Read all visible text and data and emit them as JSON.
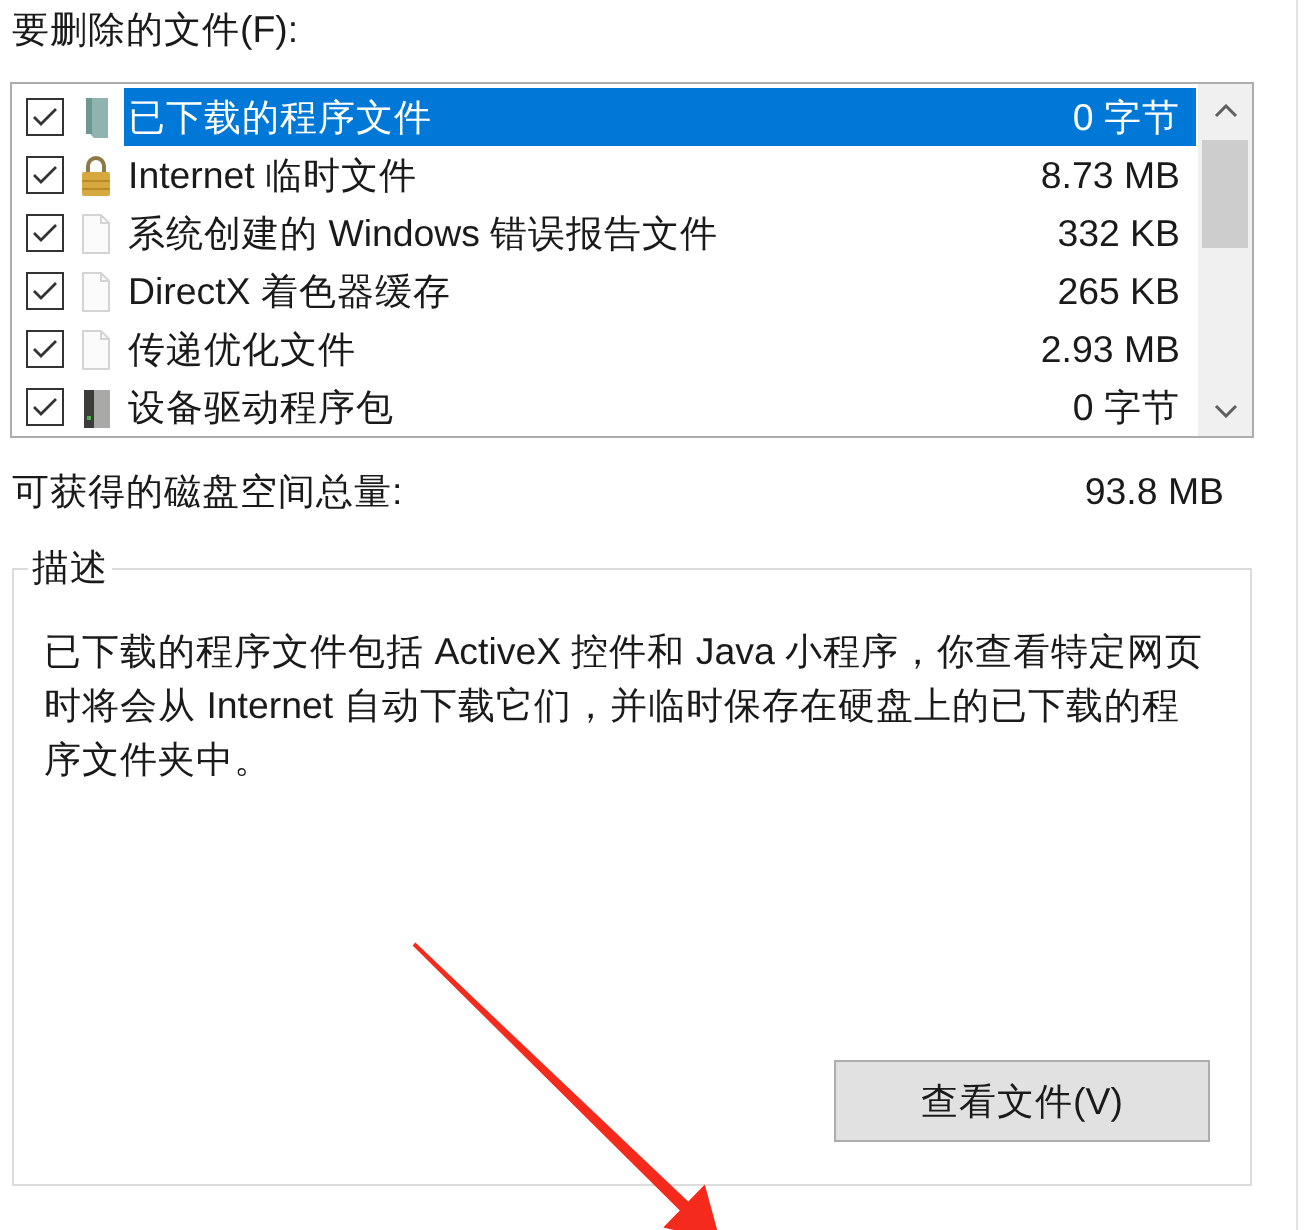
{
  "files": {
    "label": "要删除的文件(F):",
    "items": [
      {
        "kind": "book",
        "name": "已下载的程序文件",
        "size": "0 字节",
        "checked": true,
        "selected": true
      },
      {
        "kind": "lock",
        "name": "Internet 临时文件",
        "size": "8.73 MB",
        "checked": true,
        "selected": false
      },
      {
        "kind": "file",
        "name": "系统创建的 Windows 错误报告文件",
        "size": "332 KB",
        "checked": true,
        "selected": false
      },
      {
        "kind": "file",
        "name": "DirectX 着色器缓存",
        "size": "265 KB",
        "checked": true,
        "selected": false
      },
      {
        "kind": "file",
        "name": "传递优化文件",
        "size": "2.93 MB",
        "checked": true,
        "selected": false
      },
      {
        "kind": "drive",
        "name": "设备驱动程序包",
        "size": "0 字节",
        "checked": true,
        "selected": false
      }
    ]
  },
  "disk_space": {
    "label": "可获得的磁盘空间总量:",
    "value": "93.8 MB"
  },
  "description": {
    "title": "描述",
    "text": "已下载的程序文件包括 ActiveX 控件和 Java 小程序，你查看特定网页时将会从 Internet 自动下载它们，并临时保存在硬盘上的已下载的程序文件夹中。",
    "button": "查看文件(V)"
  }
}
